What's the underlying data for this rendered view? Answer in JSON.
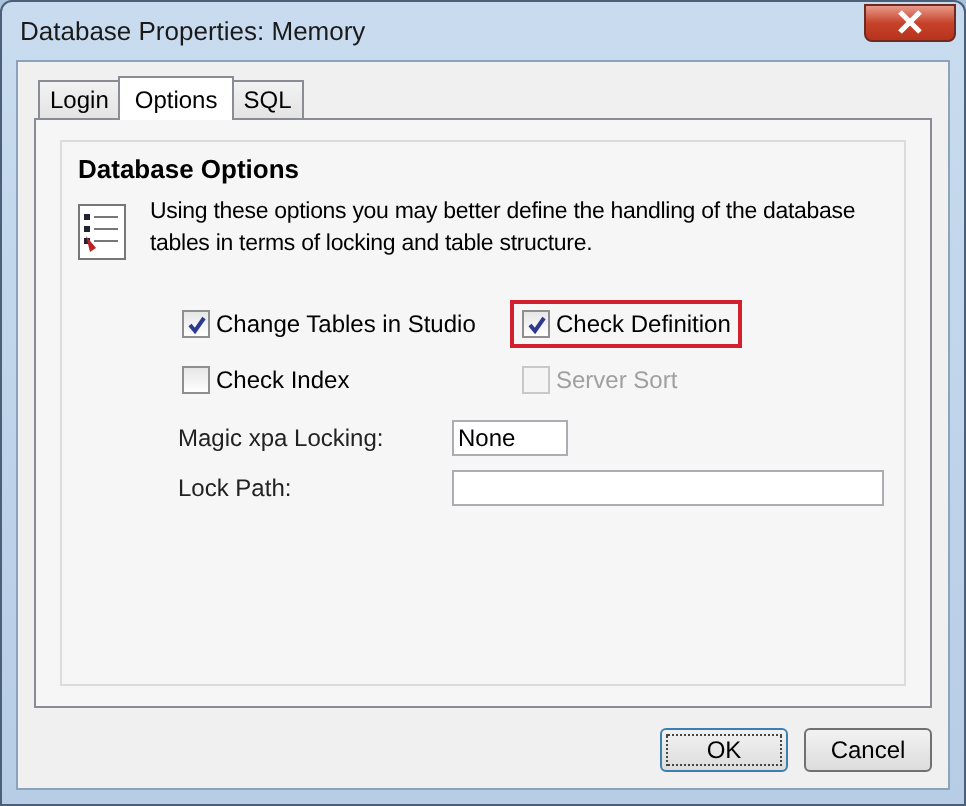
{
  "window": {
    "title": "Database Properties: Memory"
  },
  "tabs": [
    {
      "label": "Login",
      "selected": false
    },
    {
      "label": "Options",
      "selected": true
    },
    {
      "label": "SQL",
      "selected": false
    }
  ],
  "group": {
    "title": "Database Options",
    "description": "Using these options you may better define the handling of the database tables in terms of locking and table structure."
  },
  "options": [
    {
      "label": "Change Tables in Studio",
      "checked": true,
      "disabled": false,
      "highlighted": false
    },
    {
      "label": "Check Definition",
      "checked": true,
      "disabled": false,
      "highlighted": true
    },
    {
      "label": "Check Index",
      "checked": false,
      "disabled": false,
      "highlighted": false
    },
    {
      "label": "Server Sort",
      "checked": false,
      "disabled": true,
      "highlighted": false
    }
  ],
  "fields": [
    {
      "label": "Magic xpa Locking:",
      "value": "None",
      "kind": "short"
    },
    {
      "label": "Lock Path:",
      "kind": "long"
    }
  ],
  "buttons": [
    {
      "label": "OK",
      "kind": "default"
    },
    {
      "label": "Cancel",
      "kind": "normal"
    }
  ]
}
